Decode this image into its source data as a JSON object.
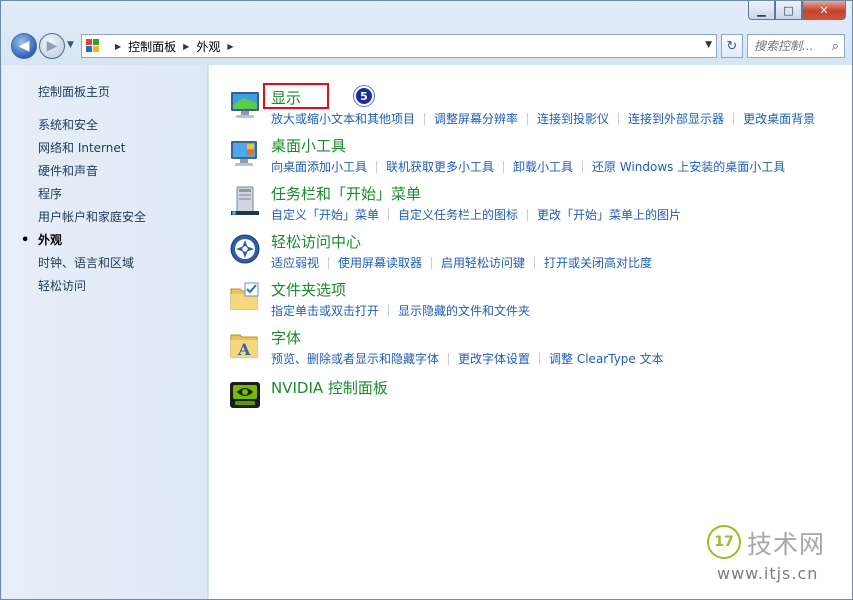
{
  "window": {
    "minimize_label": "▁",
    "maximize_label": "□",
    "close_label": "✕"
  },
  "nav": {
    "back_glyph": "◀",
    "forward_glyph": "▶",
    "history_glyph": "▼",
    "breadcrumb": [
      "控制面板",
      "外观"
    ],
    "refresh_glyph": "↻",
    "dropdown_glyph": "▼",
    "search_placeholder": "搜索控制..."
  },
  "sidebar": {
    "home_label": "控制面板主页",
    "items": [
      {
        "label": "系统和安全",
        "current": false
      },
      {
        "label": "网络和 Internet",
        "current": false
      },
      {
        "label": "硬件和声音",
        "current": false
      },
      {
        "label": "程序",
        "current": false
      },
      {
        "label": "用户帐户和家庭安全",
        "current": false
      },
      {
        "label": "外观",
        "current": true
      },
      {
        "label": "时钟、语言和区域",
        "current": false
      },
      {
        "label": "轻松访问",
        "current": false
      }
    ]
  },
  "categories": [
    {
      "title": "显示",
      "icon": "display-icon",
      "links": [
        "放大或缩小文本和其他项目",
        "调整屏幕分辨率",
        "连接到投影仪",
        "连接到外部显示器",
        "更改桌面背景"
      ]
    },
    {
      "title": "桌面小工具",
      "icon": "gadgets-icon",
      "links": [
        "向桌面添加小工具",
        "联机获取更多小工具",
        "卸载小工具",
        "还原 Windows 上安装的桌面小工具"
      ]
    },
    {
      "title": "任务栏和「开始」菜单",
      "icon": "taskbar-icon",
      "links": [
        "自定义「开始」菜单",
        "自定义任务栏上的图标",
        "更改「开始」菜单上的图片"
      ]
    },
    {
      "title": "轻松访问中心",
      "icon": "ease-of-access-icon",
      "links": [
        "适应弱视",
        "使用屏幕读取器",
        "启用轻松访问键",
        "打开或关闭高对比度"
      ]
    },
    {
      "title": "文件夹选项",
      "icon": "folder-options-icon",
      "links": [
        "指定单击或双击打开",
        "显示隐藏的文件和文件夹"
      ]
    },
    {
      "title": "字体",
      "icon": "fonts-icon",
      "links": [
        "预览、删除或者显示和隐藏字体",
        "更改字体设置",
        "调整 ClearType 文本"
      ]
    },
    {
      "title": "NVIDIA 控制面板",
      "icon": "nvidia-icon",
      "links": []
    }
  ],
  "annotation": {
    "step_number": "5",
    "highlight_color": "#e0101a"
  },
  "watermark": {
    "logo_text": "17",
    "name": "技术网",
    "url": "www.itjs.cn"
  }
}
